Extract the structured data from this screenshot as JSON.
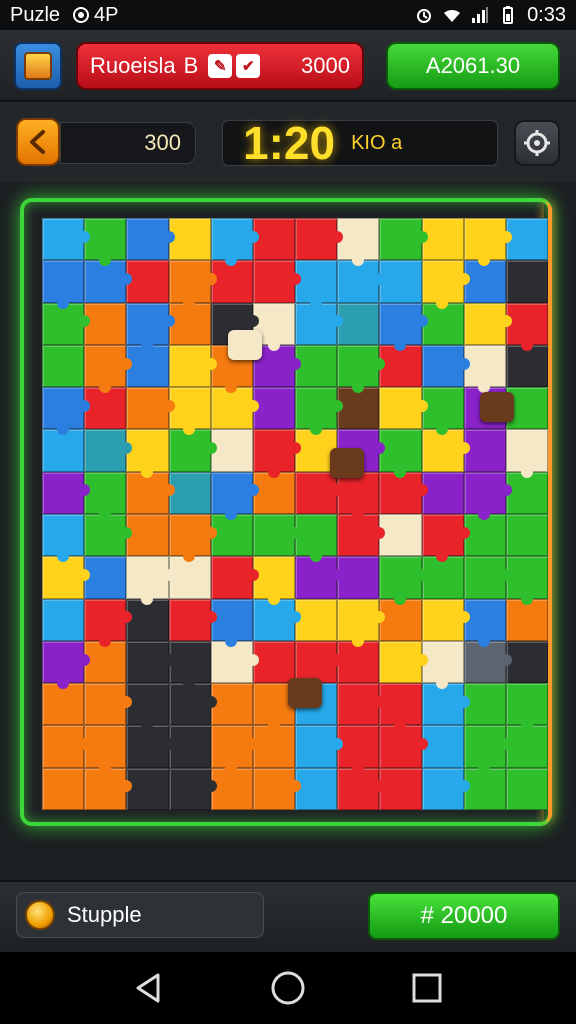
{
  "status_bar": {
    "app_name": "Puzle",
    "indicator": "4P",
    "time": "0:33"
  },
  "header": {
    "title": "Ruoeisla",
    "title_extra": "B",
    "icon_a": "✎",
    "icon_b": "✔",
    "score": "3000",
    "coins": "A2061.30"
  },
  "hud": {
    "moves": "300",
    "timer": "1:20",
    "timer_label": "KIO a"
  },
  "footer": {
    "mode_label": "Stupple",
    "buy_label": "# 20000"
  },
  "colors": {
    "red": "#e8242a",
    "orange": "#f57a10",
    "yellow": "#ffd21c",
    "green": "#2fbf2c",
    "lime": "#45d940",
    "blue": "#2a7fe0",
    "sky": "#27a8ea",
    "teal": "#2b9fb0",
    "purple": "#8a22c9",
    "cream": "#f5e8c6",
    "dark": "#2c2d33",
    "brown": "#6a3a1c",
    "gray": "#5c6470"
  },
  "board": {
    "rows": [
      [
        "sky",
        "green",
        "blue",
        "yellow",
        "sky",
        "red",
        "red",
        "cream",
        "green",
        "yellow",
        "yellow",
        "sky"
      ],
      [
        "blue",
        "blue",
        "red",
        "orange",
        "red",
        "red",
        "sky",
        "sky",
        "sky",
        "yellow",
        "blue",
        "dark"
      ],
      [
        "green",
        "orange",
        "blue",
        "orange",
        "dark",
        "cream",
        "sky",
        "teal",
        "blue",
        "green",
        "yellow",
        "red"
      ],
      [
        "green",
        "orange",
        "blue",
        "yellow",
        "orange",
        "purple",
        "green",
        "green",
        "red",
        "blue",
        "cream",
        "dark"
      ],
      [
        "blue",
        "red",
        "orange",
        "yellow",
        "yellow",
        "purple",
        "green",
        "brown",
        "yellow",
        "green",
        "purple",
        "green"
      ],
      [
        "sky",
        "teal",
        "yellow",
        "green",
        "cream",
        "red",
        "yellow",
        "purple",
        "green",
        "yellow",
        "purple",
        "cream"
      ],
      [
        "purple",
        "green",
        "orange",
        "teal",
        "blue",
        "orange",
        "red",
        "red",
        "red",
        "purple",
        "purple",
        "green"
      ],
      [
        "sky",
        "green",
        "orange",
        "orange",
        "green",
        "green",
        "green",
        "red",
        "cream",
        "red",
        "green",
        "green"
      ],
      [
        "yellow",
        "blue",
        "cream",
        "cream",
        "red",
        "yellow",
        "purple",
        "purple",
        "green",
        "green",
        "green",
        "green"
      ],
      [
        "sky",
        "red",
        "dark",
        "red",
        "blue",
        "sky",
        "yellow",
        "yellow",
        "orange",
        "yellow",
        "blue",
        "orange"
      ],
      [
        "purple",
        "orange",
        "dark",
        "dark",
        "cream",
        "red",
        "red",
        "red",
        "yellow",
        "cream",
        "gray",
        "dark"
      ],
      [
        "orange",
        "orange",
        "dark",
        "dark",
        "orange",
        "orange",
        "sky",
        "red",
        "red",
        "sky",
        "green",
        "green"
      ],
      [
        "orange",
        "orange",
        "dark",
        "dark",
        "orange",
        "orange",
        "sky",
        "red",
        "red",
        "sky",
        "green",
        "green"
      ],
      [
        "orange",
        "orange",
        "dark",
        "dark",
        "orange",
        "orange",
        "sky",
        "red",
        "red",
        "sky",
        "green",
        "green"
      ]
    ]
  },
  "loose_pieces": [
    {
      "color": "cream",
      "label": "piece-1"
    },
    {
      "color": "brown",
      "label": "piece-2"
    },
    {
      "color": "brown",
      "label": "piece-3"
    },
    {
      "color": "brown",
      "label": "piece-4"
    }
  ]
}
